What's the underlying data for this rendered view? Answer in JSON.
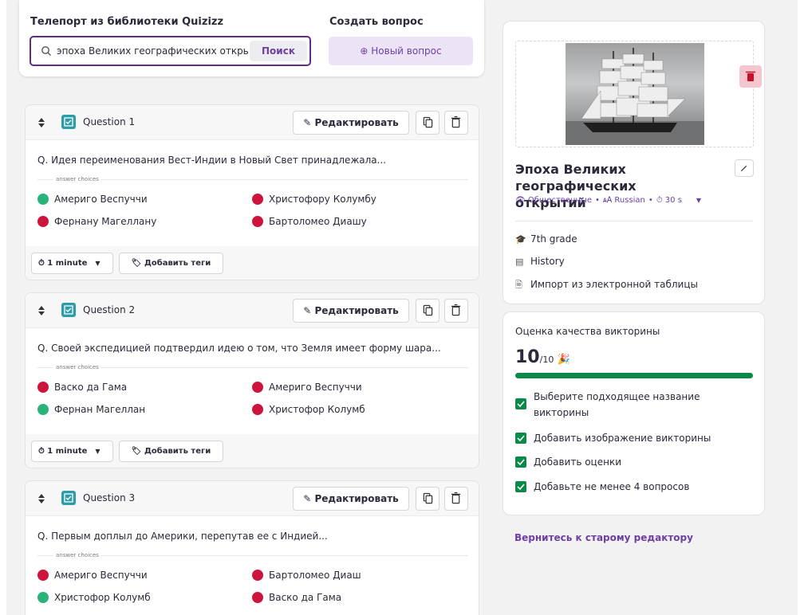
{
  "teleport": {
    "title": "Телепорт из библиотеки Quizizz",
    "search_value": "эпоха Великих географических открытий",
    "search_button": "Поиск"
  },
  "create": {
    "title": "Создать вопрос",
    "new_button": "⊕ Новый вопрос"
  },
  "edit_label": "Редактировать",
  "answer_choices_label": "answer choices",
  "questions": [
    {
      "title": "Question 1",
      "text": "Q. Идея переименования Вест-Индии в Новый Свет принадлежала...",
      "answers": [
        {
          "text": "Америго Веспуччи",
          "correct": true
        },
        {
          "text": "Христофору Колумбу",
          "correct": false
        },
        {
          "text": "Фернану Магеллану",
          "correct": false
        },
        {
          "text": "Бартоломео Диашу",
          "correct": false
        }
      ],
      "time": "1 minute",
      "tags": "Добавить теги"
    },
    {
      "title": "Question 2",
      "text": "Q. Своей экспедицией подтвердил идею о том, что Земля имеет форму шара...",
      "answers": [
        {
          "text": "Васко да Гама",
          "correct": false
        },
        {
          "text": "Америго Веспуччи",
          "correct": false
        },
        {
          "text": "Фернан Магеллан",
          "correct": true
        },
        {
          "text": "Христофор Колумб",
          "correct": false
        }
      ],
      "time": "1 minute",
      "tags": "Добавить теги"
    },
    {
      "title": "Question 3",
      "text": "Q. Первым доплыл до Америки, перепутав ее с Индией...",
      "answers": [
        {
          "text": "Америго Веспуччи",
          "correct": false
        },
        {
          "text": "Бартоломео Диаш",
          "correct": false
        },
        {
          "text": "Христофор Колумб",
          "correct": true
        },
        {
          "text": "Васко да Гама",
          "correct": false
        }
      ]
    }
  ],
  "quiz": {
    "title": "Эпоха Великих географических открытий",
    "visibility": "Общественные",
    "language": "Russian",
    "time": "30 s",
    "grade": "7th grade",
    "subject": "History",
    "import": "Импорт из электронной таблицы"
  },
  "quality": {
    "heading": "Оценка качества викторины",
    "score": "10",
    "score_max": "/10",
    "progress": 1.0,
    "items": [
      "Выберите подходящее название викторины",
      "Добавить изображение викторины",
      "Добавить оценки",
      "Добавьте не менее 4 вопросов"
    ]
  },
  "old_editor_link": "Вернитесь к старому редактору",
  "colors": {
    "accent": "#6d3fa3",
    "correct": "#2ab27b",
    "incorrect": "#d0133c",
    "progress": "#0a8a48",
    "checkbox_teal": "#2c9ca6"
  }
}
